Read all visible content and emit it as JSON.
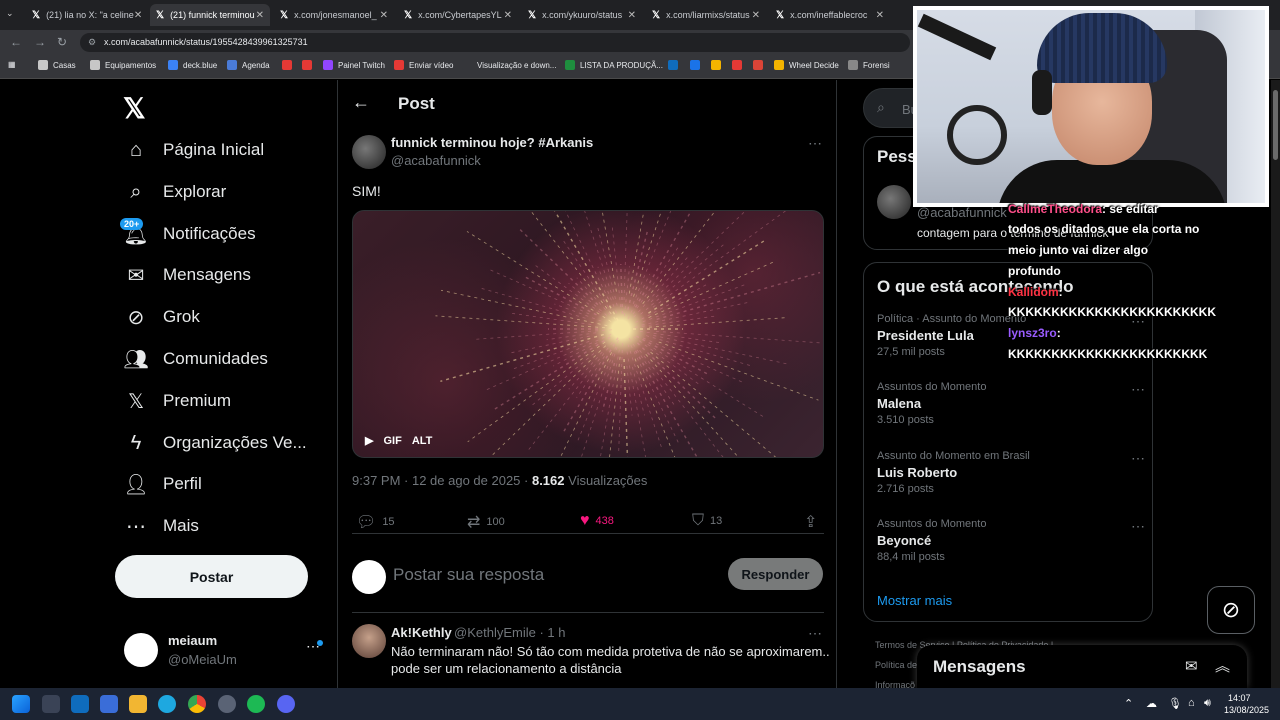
{
  "browser": {
    "tabs": [
      {
        "label": "(21) lia no X: \"a celine",
        "active": false
      },
      {
        "label": "(21) funnick terminou",
        "active": true
      },
      {
        "label": "x.com/jonesmanoel_",
        "active": false
      },
      {
        "label": "x.com/CybertapesYL",
        "active": false
      },
      {
        "label": "x.com/ykuuro/status",
        "active": false
      },
      {
        "label": "x.com/liarmixs/status",
        "active": false
      },
      {
        "label": "x.com/ineffablecroc",
        "active": false
      }
    ],
    "url": "x.com/acabafunnick/status/1955428439961325731",
    "bookmarks": [
      {
        "label": "Casas",
        "color": "#c7c7c7"
      },
      {
        "label": "Equipamentos",
        "color": "#c7c7c7"
      },
      {
        "label": "deck.blue",
        "color": "#3b82f6"
      },
      {
        "label": "Agenda",
        "color": "#4a7bd8"
      },
      {
        "label": "",
        "color": "#e53935"
      },
      {
        "label": "",
        "color": "#e53935"
      },
      {
        "label": "Painel Twitch",
        "color": "#9146ff"
      },
      {
        "label": "Enviar vídeo",
        "color": "#e53935"
      },
      {
        "label": "Visualização e down...",
        "color": "#35363a"
      },
      {
        "label": "LISTA DA PRODUÇÃ...",
        "color": "#1e8e3e"
      },
      {
        "label": "",
        "color": "#0f6cbd"
      },
      {
        "label": "",
        "color": "#1a73e8"
      },
      {
        "label": "",
        "color": "#f4b400"
      },
      {
        "label": "",
        "color": "#e53935"
      },
      {
        "label": "",
        "color": "#db4437"
      },
      {
        "label": "Wheel Decide",
        "color": "#f4b400"
      },
      {
        "label": "Forensi",
        "color": "#888888"
      }
    ]
  },
  "nav": {
    "logo": "X",
    "items": [
      {
        "label": "Página Inicial",
        "icon": "home-icon",
        "glyph": "⌂"
      },
      {
        "label": "Explorar",
        "icon": "search-icon",
        "glyph": "⌕"
      },
      {
        "label": "Notificações",
        "icon": "bell-icon",
        "glyph": "🔔︎"
      },
      {
        "label": "Mensagens",
        "icon": "mail-icon",
        "glyph": "✉"
      },
      {
        "label": "Grok",
        "icon": "grok-icon",
        "glyph": "⊘"
      },
      {
        "label": "Comunidades",
        "icon": "people-icon",
        "glyph": "👥︎"
      },
      {
        "label": "Premium",
        "icon": "x-icon",
        "glyph": "𝕏"
      },
      {
        "label": "Organizações Ve...",
        "icon": "lightning-icon",
        "glyph": "ϟ"
      },
      {
        "label": "Perfil",
        "icon": "person-icon",
        "glyph": "👤︎"
      },
      {
        "label": "Mais",
        "icon": "more-icon",
        "glyph": "⋯"
      }
    ],
    "notif_badge": "20+",
    "post_button": "Postar",
    "account": {
      "name": "meiaum",
      "handle": "@oMeiaUm"
    }
  },
  "post": {
    "header": "Post",
    "author_name": "funnick terminou hoje? #Arkanis",
    "author_handle": "@acabafunnick",
    "text": "SIM!",
    "media": {
      "play": "▶",
      "gif": "GIF",
      "alt": "ALT"
    },
    "time": "9:37 PM · 12 de ago de 2025 · ",
    "views": "8.162",
    "views_label": " Visualizações",
    "replies": "15",
    "reposts": "100",
    "likes": "438",
    "bookmarks": "13",
    "like_color": "#f91880",
    "reply_placeholder": "Postar sua resposta",
    "reply_button": "Responder"
  },
  "reply": {
    "name": "Ak!Kethly",
    "handle": "@KethlyEmile · 1 h",
    "line1": "Não terminaram não! Só tão com medida protetiva de não se aproximarem..",
    "line2": "pode ser um relacionamento a distância"
  },
  "right": {
    "search_placeholder": "Busc",
    "who_title": "Pess",
    "who_handle": "@acabafunnick",
    "who_bio": "contagem para o término de funnick",
    "trends_title": "O que está acontecendo",
    "trends": [
      {
        "context": "Política · Assunto do Momento",
        "title": "Presidente Lula",
        "posts": "27,5 mil posts"
      },
      {
        "context": "Assuntos do Momento",
        "title": "Malena",
        "posts": "3.510 posts"
      },
      {
        "context": "Assunto do Momento em Brasil",
        "title": "Luis Roberto",
        "posts": "2.716 posts"
      },
      {
        "context": "Assuntos do Momento",
        "title": "Beyoncé",
        "posts": "88,4 mil posts"
      }
    ],
    "show_more": "Mostrar mais",
    "footer1": "Termos de Serviço  |  Política de Privacidade  |",
    "footer2": "Política de",
    "footer3": "Informaçõ"
  },
  "messages": {
    "title": "Mensagens"
  },
  "chat": [
    {
      "user": "CallmeTheodora",
      "text": ": se editar"
    },
    {
      "user": "",
      "text": "todos os ditados que ela corta no"
    },
    {
      "user": "",
      "text": "meio junto vai dizer algo"
    },
    {
      "user": "",
      "text": "profundo"
    },
    {
      "user": "Kallidom",
      "text": ":"
    },
    {
      "user": "",
      "text": "KKKKKKKKKKKKKKKKKKKKKKKK"
    },
    {
      "user": "lynsz3ro",
      "text": ":"
    },
    {
      "user": "",
      "text": "KKKKKKKKKKKKKKKKKKKKKKK"
    }
  ],
  "taskbar": {
    "time": "14:07",
    "date": "13/08/2025"
  }
}
